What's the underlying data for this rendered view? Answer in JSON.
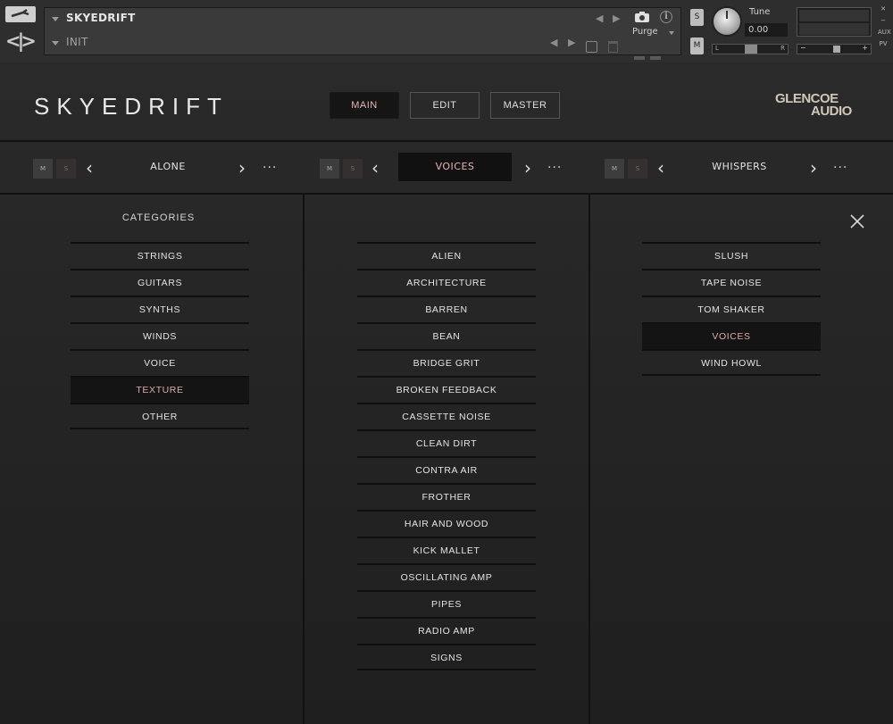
{
  "kontakt": {
    "instrument_name": "SKYEDRIFT",
    "snapshot_name": "INIT",
    "purge_label": "Purge",
    "tune_label": "Tune",
    "tune_value": "0.00",
    "solo_label": "S",
    "mute_label": "M",
    "pan_left": "L",
    "pan_right": "R",
    "vol_minus": "−",
    "vol_plus": "+",
    "aux_label": "AUX",
    "pv_label": "PV"
  },
  "header": {
    "logo": "SKYEDRIFT",
    "brand_line1": "GLENCOE",
    "brand_line2": "AUDIO",
    "tabs": [
      {
        "label": "MAIN",
        "active": true
      },
      {
        "label": "EDIT",
        "active": false
      },
      {
        "label": "MASTER",
        "active": false
      }
    ]
  },
  "layers": [
    {
      "name": "ALONE",
      "m": "M",
      "s": "S",
      "selected": false
    },
    {
      "name": "VOICES",
      "m": "M",
      "s": "S",
      "selected": true
    },
    {
      "name": "WHISPERS",
      "m": "M",
      "s": "S",
      "selected": false
    }
  ],
  "categories": {
    "title": "CATEGORIES",
    "items": [
      "STRINGS",
      "GUITARS",
      "SYNTHS",
      "WINDS",
      "VOICE",
      "TEXTURE",
      "OTHER"
    ],
    "selected": "TEXTURE"
  },
  "subcategories": {
    "items": [
      "ALIEN",
      "ARCHITECTURE",
      "BARREN",
      "BEAN",
      "BRIDGE GRIT",
      "BROKEN FEEDBACK",
      "CASSETTE NOISE",
      "CLEAN DIRT",
      "CONTRA AIR",
      "FROTHER",
      "HAIR AND WOOD",
      "KICK MALLET",
      "OSCILLATING AMP",
      "PIPES",
      "RADIO AMP",
      "SIGNS"
    ]
  },
  "samples": {
    "items": [
      "SLUSH",
      "TAPE NOISE",
      "TOM SHAKER",
      "VOICES",
      "WIND HOWL"
    ],
    "selected": "VOICES"
  },
  "colors": {
    "accent": "#e6b4b4",
    "background": "#1f1f1f",
    "selected_bg": "#141414"
  }
}
